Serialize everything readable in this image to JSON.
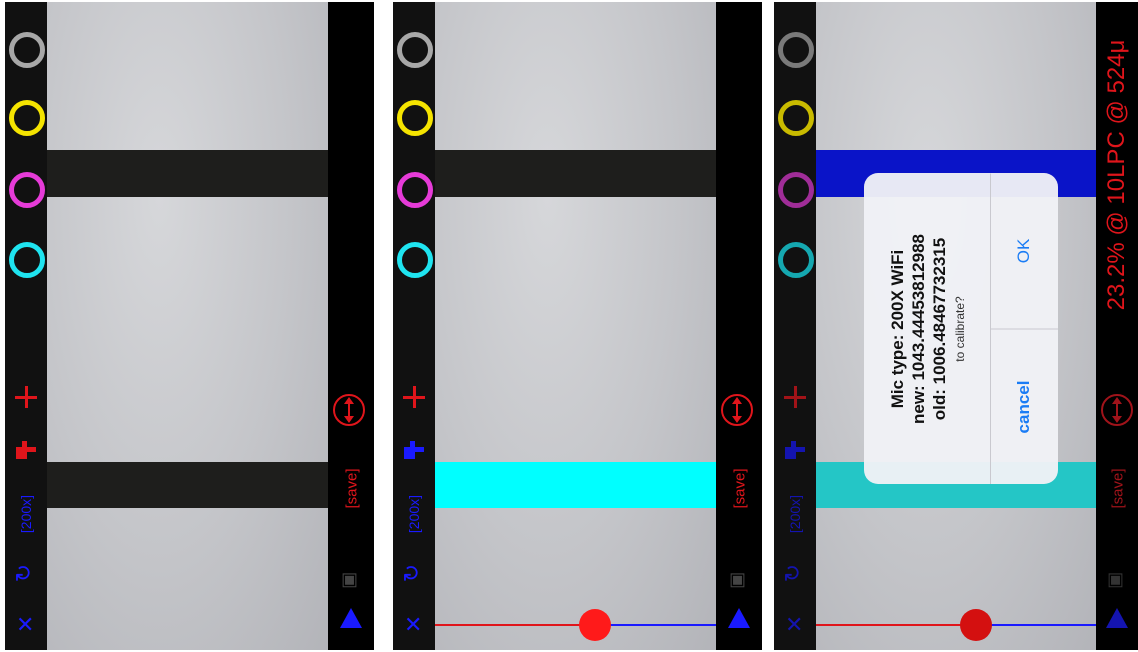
{
  "colors": {
    "gray_ring": "#a8a8a8",
    "yellow_ring": "#f5e400",
    "magenta_ring": "#e63bd8",
    "cyan_ring": "#1fe4f0",
    "red_accent": "#e0151b",
    "blue_accent": "#1a1aff",
    "cyan_band": "#00ffff",
    "blue_band": "#0a14c8",
    "teal_band": "#24c6c6",
    "dark_band": "#1e1e1c"
  },
  "sidebar": {
    "icons": [
      "gray-circle-icon",
      "yellow-circle-icon",
      "magenta-circle-icon",
      "cyan-circle-icon",
      "plus-icon",
      "pointing-hand-icon",
      "undo-icon",
      "close-icon"
    ],
    "mode_label": "[200x]"
  },
  "rightbar": {
    "save_label": "[save]",
    "icons": [
      "vertical-measure-icon",
      "camera-icon",
      "triangle-up-icon"
    ]
  },
  "panel3": {
    "measurement": "23.2% @ 10LPC @ 524μ"
  },
  "slider": {
    "panel2_position": 0.57,
    "panel3_position": 0.57
  },
  "dialog": {
    "line1": "Mic type: 200X WiFi",
    "line2": "new: 1043.44453812988",
    "line3": "old: 1006.48467732315",
    "message": "to calibrate?",
    "cancel_label": "cancel",
    "ok_label": "OK"
  }
}
